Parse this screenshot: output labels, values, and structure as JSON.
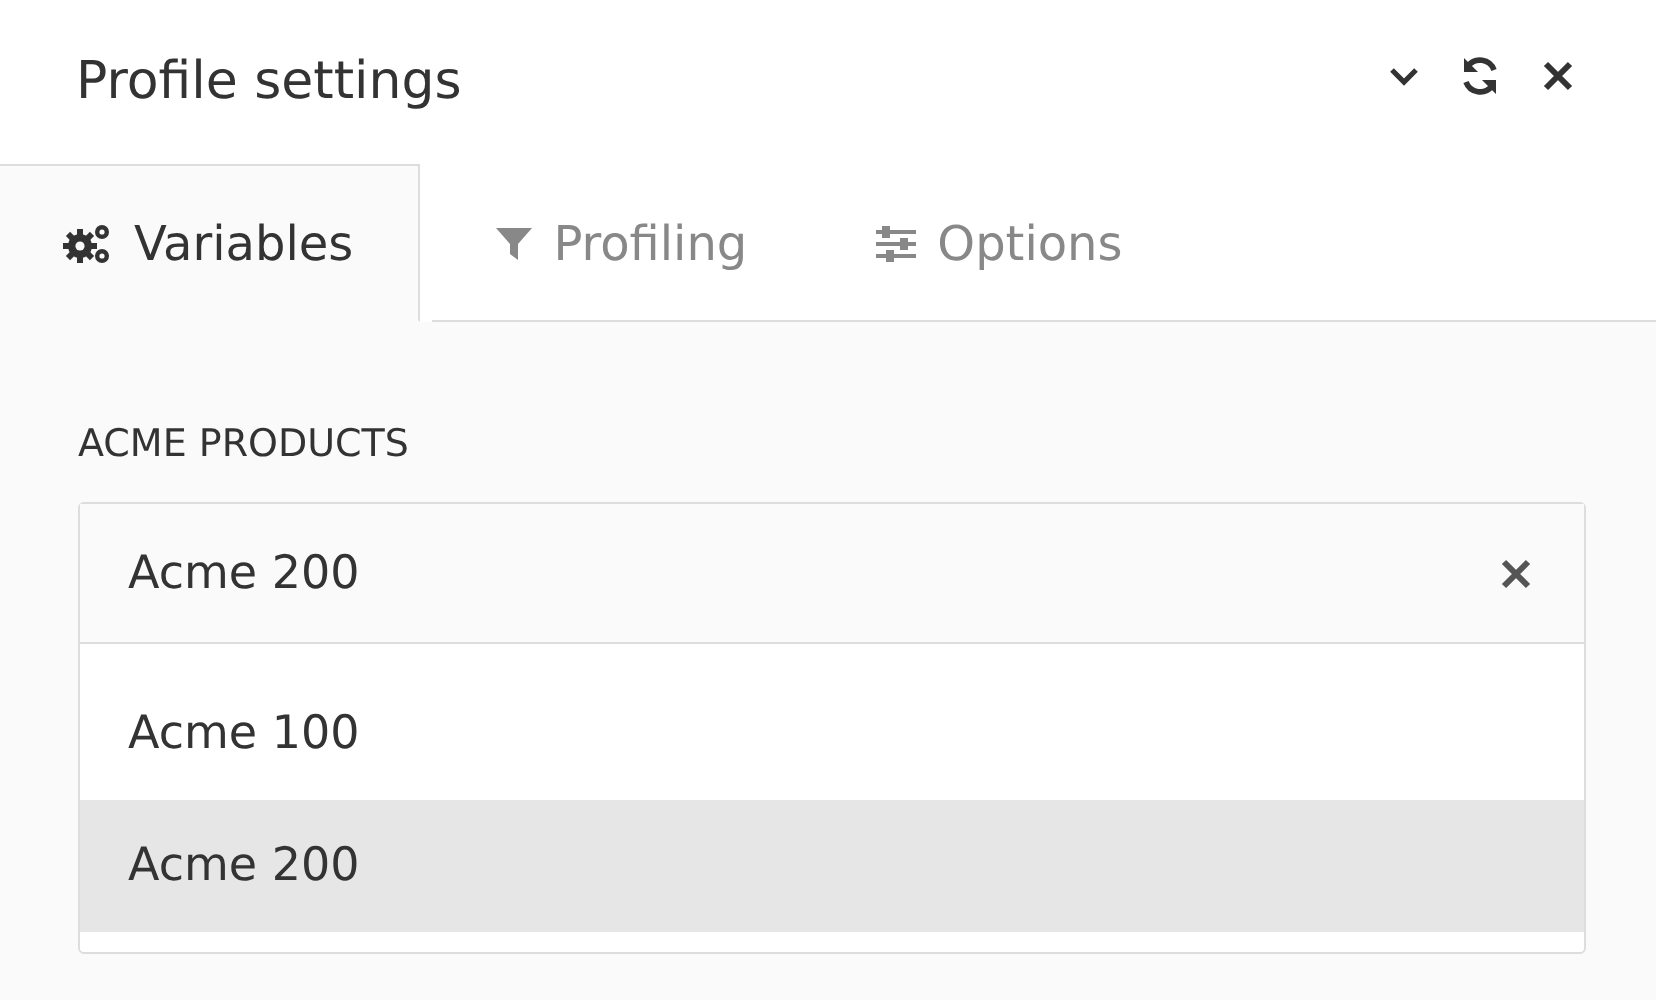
{
  "panel": {
    "title": "Profile settings"
  },
  "tabs": [
    {
      "label": "Variables",
      "kind": "gears",
      "selected": true
    },
    {
      "label": "Profiling",
      "kind": "filter",
      "selected": false
    },
    {
      "label": "Options",
      "kind": "sliders",
      "selected": false
    }
  ],
  "field": {
    "label": "ACME PRODUCTS",
    "value": "Acme 200"
  },
  "options": [
    {
      "label": "Acme 100",
      "selected": false
    },
    {
      "label": "Acme 200",
      "selected": true
    }
  ]
}
